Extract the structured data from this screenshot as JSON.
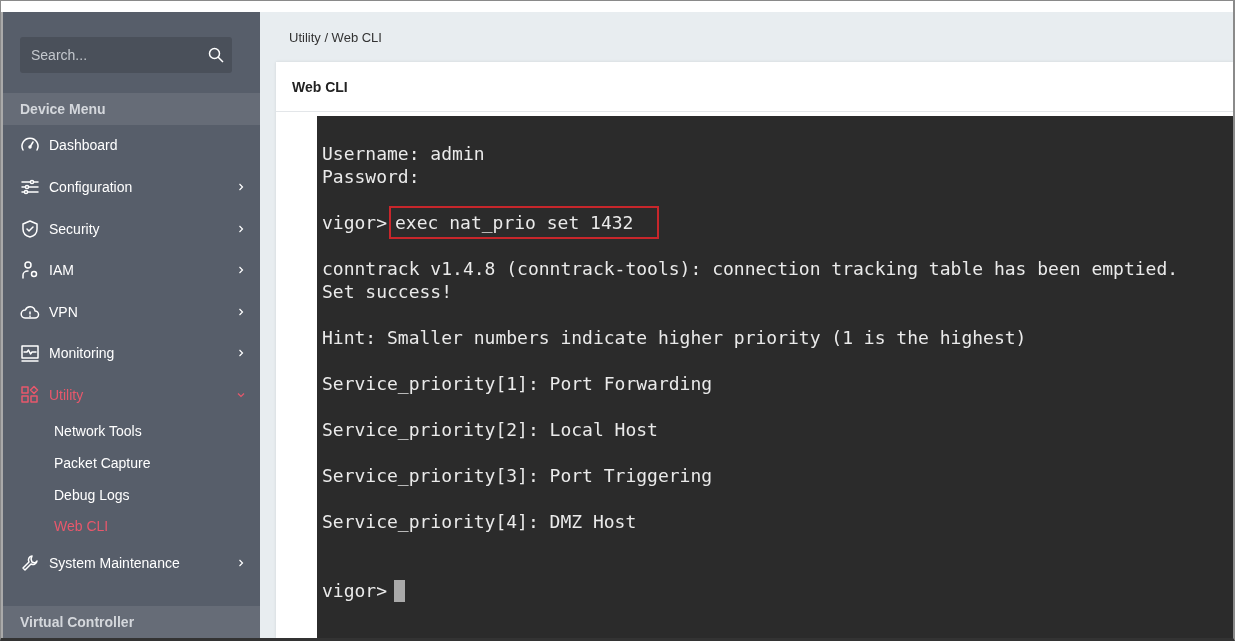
{
  "sidebar": {
    "search": {
      "placeholder": "Search..."
    },
    "sections": [
      {
        "title": "Device Menu",
        "items": [
          {
            "label": "Dashboard",
            "has_submenu": false,
            "expanded": false,
            "selected": false
          },
          {
            "label": "Configuration",
            "has_submenu": true,
            "expanded": false,
            "selected": false
          },
          {
            "label": "Security",
            "has_submenu": true,
            "expanded": false,
            "selected": false
          },
          {
            "label": "IAM",
            "has_submenu": true,
            "expanded": false,
            "selected": false
          },
          {
            "label": "VPN",
            "has_submenu": true,
            "expanded": false,
            "selected": false
          },
          {
            "label": "Monitoring",
            "has_submenu": true,
            "expanded": false,
            "selected": false
          },
          {
            "label": "Utility",
            "has_submenu": true,
            "expanded": true,
            "selected": true,
            "children": [
              {
                "label": "Network Tools",
                "selected": false
              },
              {
                "label": "Packet Capture",
                "selected": false
              },
              {
                "label": "Debug Logs",
                "selected": false
              },
              {
                "label": "Web CLI",
                "selected": true
              }
            ]
          },
          {
            "label": "System Maintenance",
            "has_submenu": true,
            "expanded": false,
            "selected": false
          }
        ]
      },
      {
        "title": "Virtual Controller"
      }
    ]
  },
  "breadcrumb": "Utility / Web CLI",
  "card": {
    "title": "Web CLI"
  },
  "terminal": {
    "lines": [
      {
        "kind": "output",
        "text": "Username: admin"
      },
      {
        "kind": "output",
        "text": "Password:"
      },
      {
        "kind": "blank"
      },
      {
        "kind": "command",
        "prompt": "vigor>",
        "text": "exec nat_prio set 1432"
      },
      {
        "kind": "blank"
      },
      {
        "kind": "output",
        "text": "conntrack v1.4.8 (conntrack-tools): connection tracking table has been emptied."
      },
      {
        "kind": "output",
        "text": "Set success!"
      },
      {
        "kind": "blank"
      },
      {
        "kind": "output",
        "text": "Hint: Smaller numbers indicate higher priority (1 is the highest)"
      },
      {
        "kind": "blank"
      },
      {
        "kind": "output",
        "text": "Service_priority[1]: Port Forwarding"
      },
      {
        "kind": "blank"
      },
      {
        "kind": "output",
        "text": "Service_priority[2]: Local Host"
      },
      {
        "kind": "blank"
      },
      {
        "kind": "output",
        "text": "Service_priority[3]: Port Triggering"
      },
      {
        "kind": "blank"
      },
      {
        "kind": "output",
        "text": "Service_priority[4]: DMZ Host"
      },
      {
        "kind": "blank"
      },
      {
        "kind": "blank"
      },
      {
        "kind": "cursor",
        "prompt": "vigor>"
      }
    ]
  }
}
